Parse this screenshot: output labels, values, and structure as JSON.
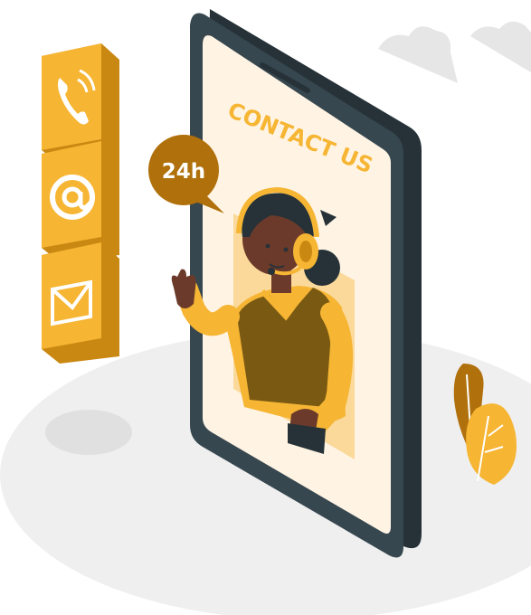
{
  "illustration": {
    "screen_title": "CONTACT US",
    "bubble_label": "24h",
    "icons": [
      "phone-icon",
      "at-sign-icon",
      "envelope-icon"
    ],
    "colors": {
      "accent": "#F6B533",
      "accent_dark": "#C98812",
      "phone_body": "#37474F",
      "screen": "#FFF4E4",
      "bubble": "#B0700B",
      "skin": "#6B3A2A",
      "vest": "#7A5A12",
      "shadow": "#EBEBEB"
    }
  }
}
